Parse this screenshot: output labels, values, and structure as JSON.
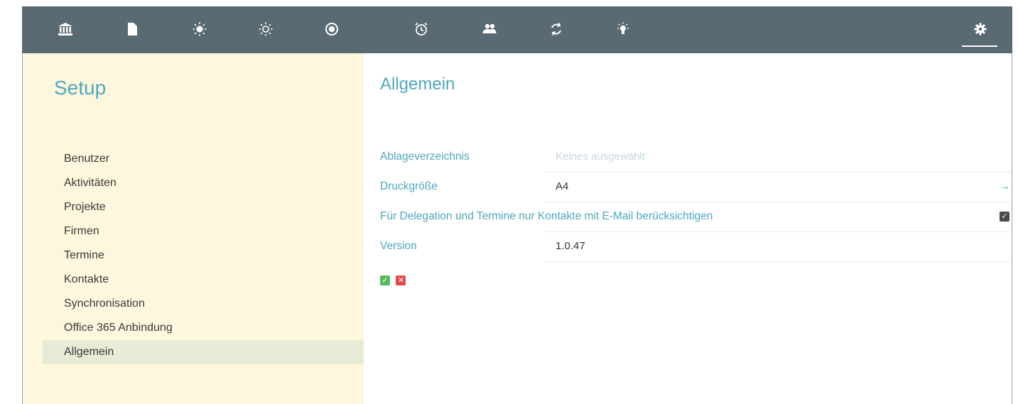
{
  "toolbar": {
    "icons": [
      "bank-icon",
      "document-icon",
      "sun-icon",
      "sun-outline-icon",
      "record-icon",
      "alarm-clock-icon",
      "users-icon",
      "sync-icon",
      "lightbulb-icon",
      "gear-icon"
    ],
    "active": "gear-icon",
    "colors": {
      "background": "#596a72",
      "icon": "#ffffff"
    }
  },
  "sidebar": {
    "title": "Setup",
    "items": [
      {
        "label": "Benutzer"
      },
      {
        "label": "Aktivitäten"
      },
      {
        "label": "Projekte"
      },
      {
        "label": "Firmen"
      },
      {
        "label": "Termine"
      },
      {
        "label": "Kontakte"
      },
      {
        "label": "Synchronisation"
      },
      {
        "label": "Office 365 Anbindung"
      },
      {
        "label": "Allgemein",
        "active": true
      }
    ],
    "colors": {
      "background": "#fdf8dd",
      "active_background": "#e6ecd6"
    }
  },
  "main": {
    "title": "Allgemein",
    "settings": {
      "ablage": {
        "label": "Ablageverzeichnis",
        "placeholder": "Keines ausgewählt"
      },
      "druck": {
        "label": "Druckgröße",
        "value": "A4",
        "arrow": "→"
      },
      "delegation": {
        "label": "Für Delegation und Termine nur Kontakte mit E-Mail berücksichtigen",
        "checked": true,
        "check_glyph": "✓"
      },
      "version": {
        "label": "Version",
        "value": "1.0.47"
      }
    },
    "actions": {
      "confirm_glyph": "✓",
      "cancel_glyph": "✕"
    },
    "colors": {
      "accent": "#4fa6bd",
      "confirm": "#5cb85c",
      "cancel": "#e04a4a"
    }
  }
}
